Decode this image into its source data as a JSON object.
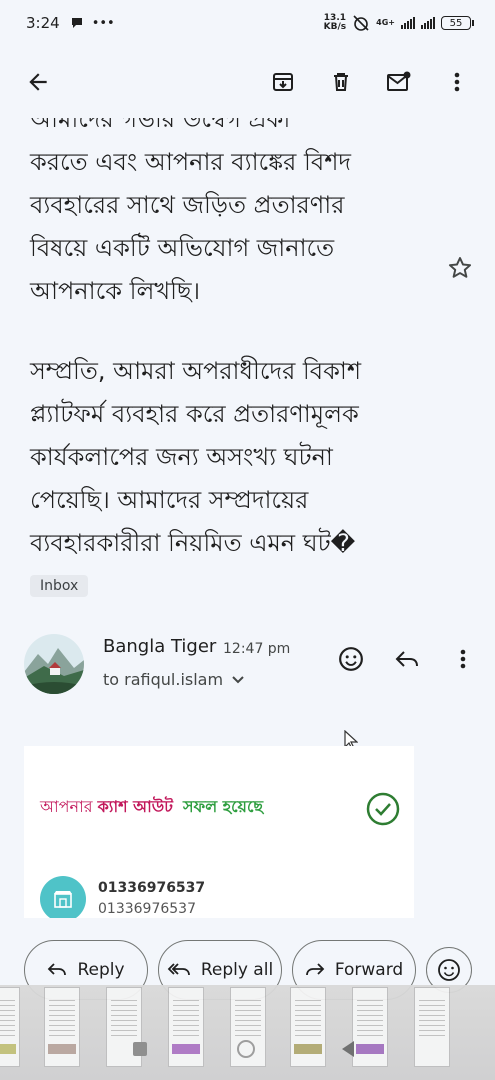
{
  "status_bar": {
    "time": "3:24",
    "speed_value": "13.1",
    "speed_unit": "KB/s",
    "network": "4G+",
    "battery": "55"
  },
  "app_bar": {
    "back_icon": "arrow-left-icon",
    "actions": [
      "archive-icon",
      "delete-icon",
      "mark-unread-icon",
      "more-vert-icon"
    ]
  },
  "message": {
    "paragraph1_partial": "আমাদের গভীর উদ্বেগ প্রকা",
    "paragraph1_lines": [
      "করতে এবং আপনার ব্যাঙ্কের বিশদ",
      "ব্যবহারের সাথে জড়িত প্রতারণার",
      "বিষয়ে একটি অভিযোগ জানাতে",
      "আপনাকে লিখছি।"
    ],
    "paragraph2_lines": [
      "সম্প্রতি, আমরা অপরাধীদের বিকাশ",
      "প্ল্যাটফর্ম ব্যবহার করে প্রতারণামূলক",
      "কার্যকলাপের জন্য অসংখ্য ঘটনা",
      "পেয়েছি। আমাদের সম্প্রদায়ের",
      "ব্যবহারকারীরা নিয়মিত এমন ঘট�"
    ],
    "label": "Inbox"
  },
  "sender": {
    "name": "Bangla Tiger",
    "time": "12:47 pm",
    "to": "to rafiqul.islam"
  },
  "card": {
    "headline_part1": "আপনার ",
    "headline_part2": "ক্যাশ আউট",
    "headline_part3": "সফল হয়েছে",
    "number1": "01336976537",
    "number2": "01336976537"
  },
  "bottom_actions": {
    "reply": "Reply",
    "reply_all": "Reply all",
    "forward": "Forward"
  },
  "colors": {
    "background": "#f3f6fb",
    "headline_pink": "#c2185b",
    "headline_green": "#2e9e3f",
    "check_green": "#2e7d32",
    "shop_teal": "#4fc3c8"
  }
}
